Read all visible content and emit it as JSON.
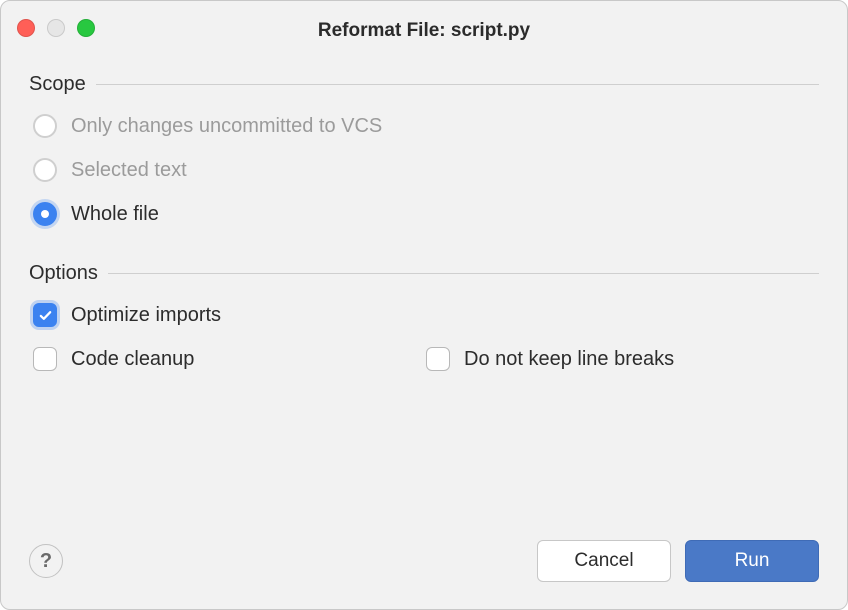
{
  "title": "Reformat File: script.py",
  "sections": {
    "scope": {
      "heading": "Scope",
      "options": {
        "uncommitted": "Only changes uncommitted to VCS",
        "selected_text": "Selected text",
        "whole_file": "Whole file"
      },
      "selected": "whole_file"
    },
    "options": {
      "heading": "Options",
      "optimize_imports": {
        "label": "Optimize imports",
        "checked": true
      },
      "code_cleanup": {
        "label": "Code cleanup",
        "checked": false
      },
      "no_line_breaks": {
        "label": "Do not keep line breaks",
        "checked": false
      }
    }
  },
  "buttons": {
    "help": "?",
    "cancel": "Cancel",
    "run": "Run"
  }
}
